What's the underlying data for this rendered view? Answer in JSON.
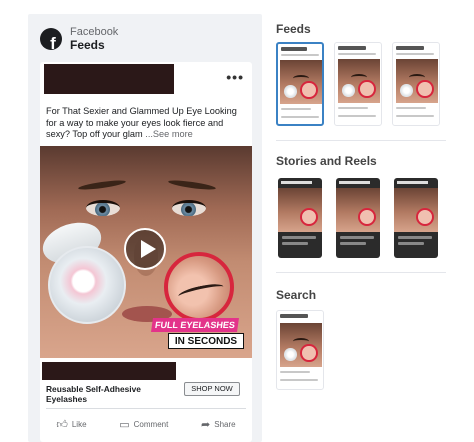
{
  "preview": {
    "brand": "Facebook",
    "placement": "Feeds",
    "logo_letter": "f",
    "more_icon": "•••",
    "primary_text": "For That Sexier and Glammed Up Eye Looking for a way to make your eyes look fierce and sexy? Top off your glam",
    "see_more": "...See more",
    "banner_line1": "FULL EYELASHES",
    "banner_line2": "IN SECONDS",
    "headline": "Reusable Self-Adhesive Eyelashes",
    "cta": "SHOP NOW",
    "actions": [
      {
        "icon": "like-icon",
        "label": "Like"
      },
      {
        "icon": "comment-icon",
        "label": "Comment"
      },
      {
        "icon": "share-icon",
        "label": "Share"
      }
    ]
  },
  "placements": {
    "feeds_title": "Feeds",
    "stories_title": "Stories and Reels",
    "search_title": "Search"
  },
  "colors": {
    "accent_selected": "#3b82c4",
    "banner_pink": "#e3338a"
  }
}
